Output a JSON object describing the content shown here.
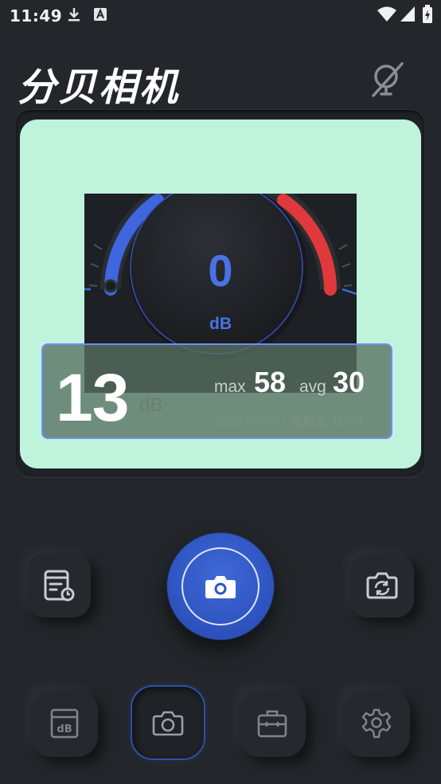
{
  "status_bar": {
    "time": "11:49"
  },
  "header": {
    "title": "分贝相机"
  },
  "gauge": {
    "value": "0",
    "unit": "dB"
  },
  "overlay": {
    "level": "13",
    "unit": "dB",
    "max_label": "max",
    "max_value": "58",
    "avg_label": "avg",
    "avg_value": "30",
    "datetime": "2025-05-09 / 星期五 11:49"
  },
  "controls": {
    "left_icon": "history-list-icon",
    "shutter_icon": "camera-icon",
    "right_icon": "switch-camera-icon"
  },
  "bottom_nav": [
    {
      "icon": "decibel-meter-icon",
      "active": false
    },
    {
      "icon": "camera-icon",
      "active": true
    },
    {
      "icon": "toolbox-icon",
      "active": false
    },
    {
      "icon": "settings-gear-icon",
      "active": false
    }
  ],
  "colors": {
    "background": "#23272b",
    "preview": "#bff3dc",
    "accent_blue": "#4a72e6",
    "shutter_blue": "#2f55c2",
    "gauge_red": "#e0393b"
  }
}
